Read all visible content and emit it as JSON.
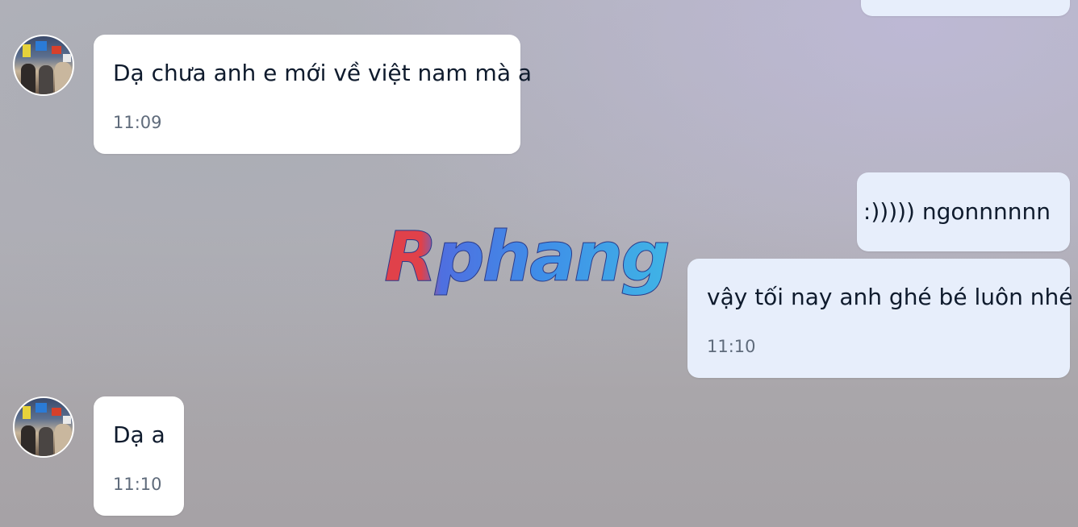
{
  "messages": [
    {
      "text": "Dạ chưa anh e mới về việt nam mà a",
      "time": "11:09"
    },
    {
      "text": ":))))) ngonnnnnn"
    },
    {
      "text": "vậy tối nay anh ghé bé luôn nhé",
      "time": "11:10"
    },
    {
      "text": "Dạ a",
      "time": "11:10"
    }
  ],
  "watermark": {
    "text": "Rphang"
  },
  "colors": {
    "incoming_bubble": "#ffffff",
    "outgoing_bubble": "#e7eefb",
    "text": "#0f1b2d",
    "time": "#5f6b7b",
    "watermark_red": "#e0414a",
    "watermark_blue": "#3fa6e6"
  },
  "icons": {
    "avatar": "contact-avatar-photo"
  }
}
